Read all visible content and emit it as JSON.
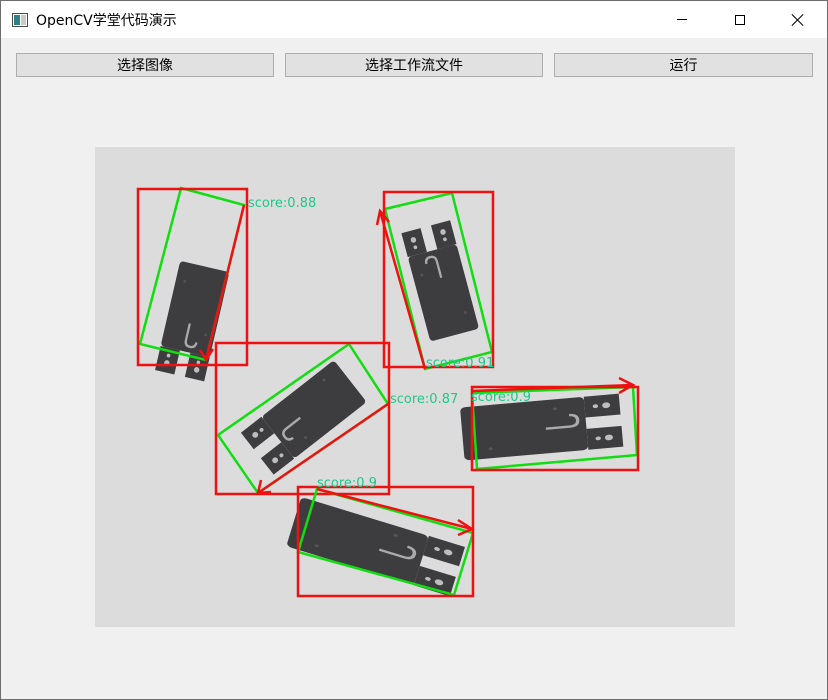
{
  "window": {
    "title": "OpenCV学堂代码演示"
  },
  "toolbar": {
    "select_image_label": "选择图像",
    "select_workflow_label": "选择工作流文件",
    "run_label": "运行"
  },
  "result_view": {
    "detections": [
      {
        "score": "score:0.88"
      },
      {
        "score": "score:0.91"
      },
      {
        "score": "score:0.87"
      },
      {
        "score": "score:0.9"
      },
      {
        "score": "score:0.9"
      }
    ]
  },
  "colors": {
    "bbox": "#ee1111",
    "rotated_box": "#11dd11",
    "score_text": "#1fc88a",
    "part": "#3d3d3f",
    "background": "#dcdcdc"
  }
}
